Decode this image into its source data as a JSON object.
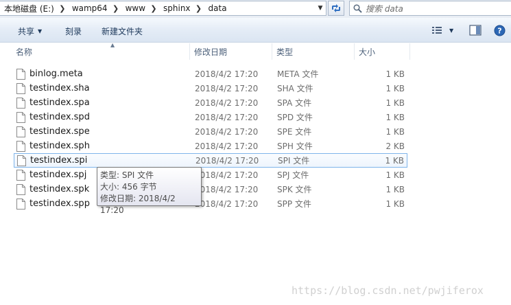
{
  "address_bar": {
    "crumbs": [
      "本地磁盘 (E:)",
      "wamp64",
      "www",
      "sphinx",
      "data"
    ],
    "dropdown_icon": "chevron-down-icon"
  },
  "search": {
    "placeholder": "搜索 data"
  },
  "toolbar": {
    "share_label": "共享",
    "burn_label": "刻录",
    "new_folder_label": "新建文件夹"
  },
  "columns": {
    "name": "名称",
    "date": "修改日期",
    "type": "类型",
    "size": "大小"
  },
  "files": [
    {
      "name": "binlog.meta",
      "date": "2018/4/2 17:20",
      "type": "META 文件",
      "size": "1 KB"
    },
    {
      "name": "testindex.sha",
      "date": "2018/4/2 17:20",
      "type": "SHA 文件",
      "size": "1 KB"
    },
    {
      "name": "testindex.spa",
      "date": "2018/4/2 17:20",
      "type": "SPA 文件",
      "size": "1 KB"
    },
    {
      "name": "testindex.spd",
      "date": "2018/4/2 17:20",
      "type": "SPD 文件",
      "size": "1 KB"
    },
    {
      "name": "testindex.spe",
      "date": "2018/4/2 17:20",
      "type": "SPE 文件",
      "size": "1 KB"
    },
    {
      "name": "testindex.sph",
      "date": "2018/4/2 17:20",
      "type": "SPH 文件",
      "size": "2 KB"
    },
    {
      "name": "testindex.spi",
      "date": "2018/4/2 17:20",
      "type": "SPI 文件",
      "size": "1 KB"
    },
    {
      "name": "testindex.spj",
      "date": "2018/4/2 17:20",
      "type": "SPJ 文件",
      "size": "1 KB"
    },
    {
      "name": "testindex.spk",
      "date": "2018/4/2 17:20",
      "type": "SPK 文件",
      "size": "1 KB"
    },
    {
      "name": "testindex.spp",
      "date": "2018/4/2 17:20",
      "type": "SPP 文件",
      "size": "1 KB"
    }
  ],
  "hovered_index": 6,
  "tooltip": {
    "type_line": "类型: SPI 文件",
    "size_line": "大小: 456 字节",
    "date_line": "修改日期: 2018/4/2 17:20"
  },
  "watermark": "https://blog.csdn.net/pwjiferox",
  "colors": {
    "accent": "#1e395b",
    "hover_border": "#7eb4ea",
    "muted_text": "#6d6d6d"
  }
}
